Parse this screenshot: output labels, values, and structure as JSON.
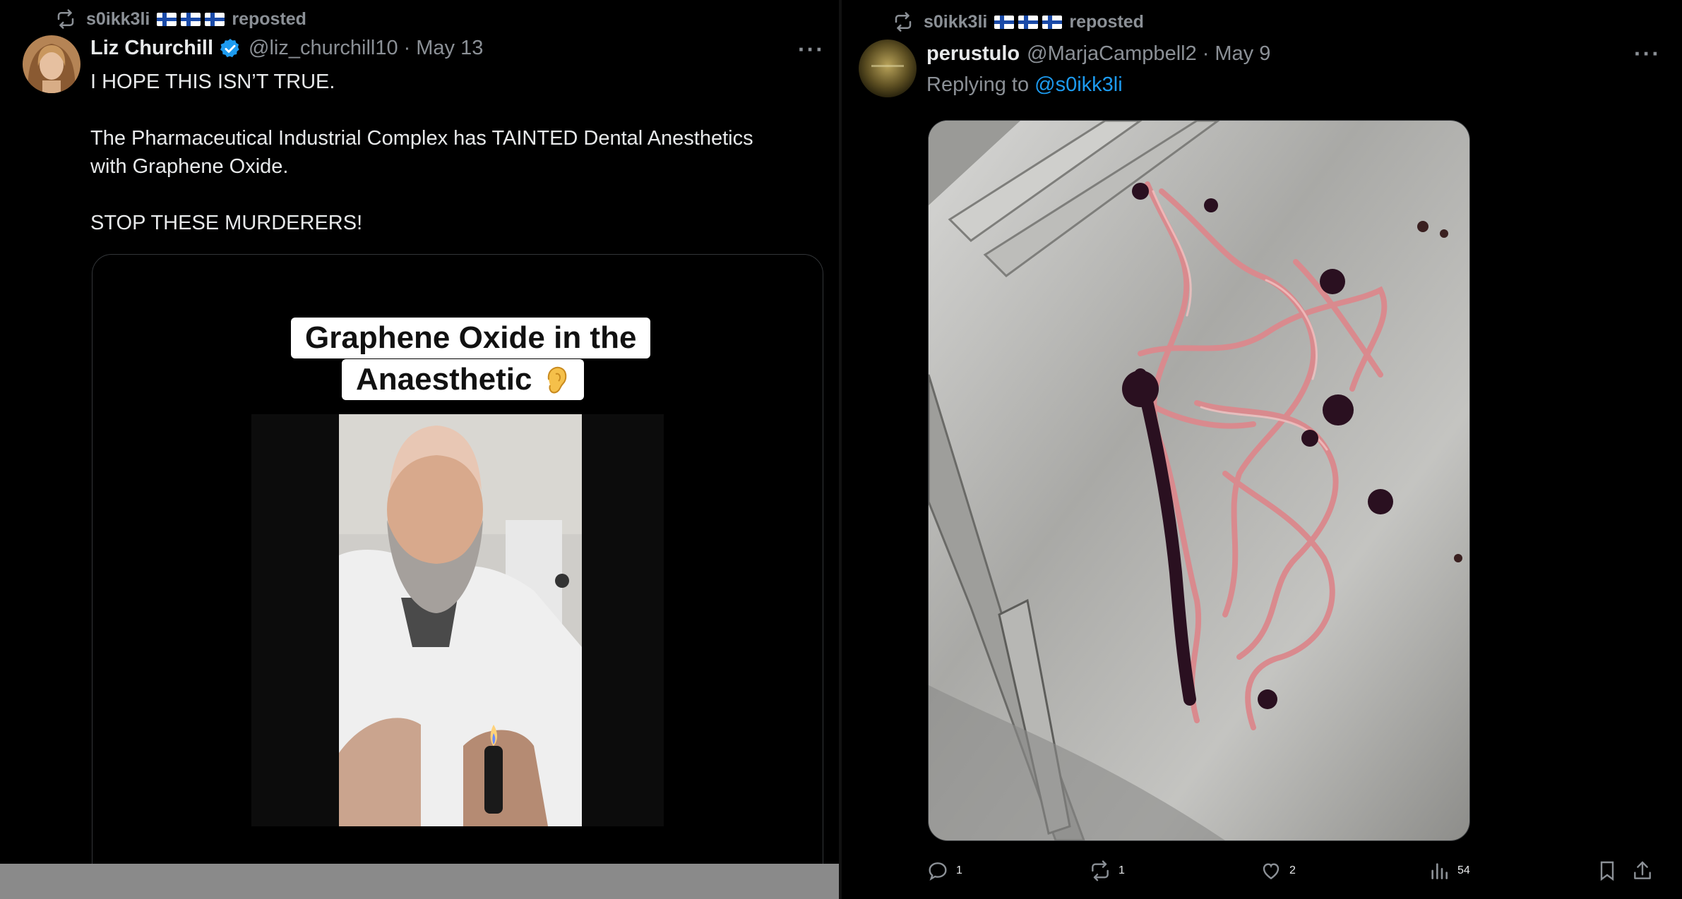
{
  "left_post": {
    "repost_user": "s0ikk3li",
    "repost_label": "reposted",
    "author_name": "Liz Churchill",
    "author_handle": "@liz_churchill10",
    "date": "May 13",
    "text_line1": "I HOPE THIS ISN’T TRUE.",
    "text_para2_line1": "The Pharmaceutical Industrial Complex has TAINTED Dental Anesthetics",
    "text_para2_line2": "with Graphene Oxide.",
    "text_para3": "STOP THESE MURDERERS!",
    "video_caption_line1": "Graphene Oxide in the",
    "video_caption_line2": "Anaesthetic",
    "caption_emoji": "ear"
  },
  "right_post": {
    "repost_user": "s0ikk3li",
    "repost_label": "reposted",
    "author_name": "perustulo",
    "author_handle": "@MarjaCampbell2",
    "date": "May 9",
    "replying_label": "Replying to",
    "replying_handle": "@s0ikk3li",
    "image_icon": "steel-tray-with-red-fibers-photo",
    "actions": {
      "replies": "1",
      "reposts": "1",
      "likes": "2",
      "views": "54"
    }
  },
  "colors": {
    "background": "#000000",
    "text": "#e7e9ea",
    "muted": "#8b9096",
    "link": "#1d9bf0",
    "verified": "#1d9bf0"
  }
}
